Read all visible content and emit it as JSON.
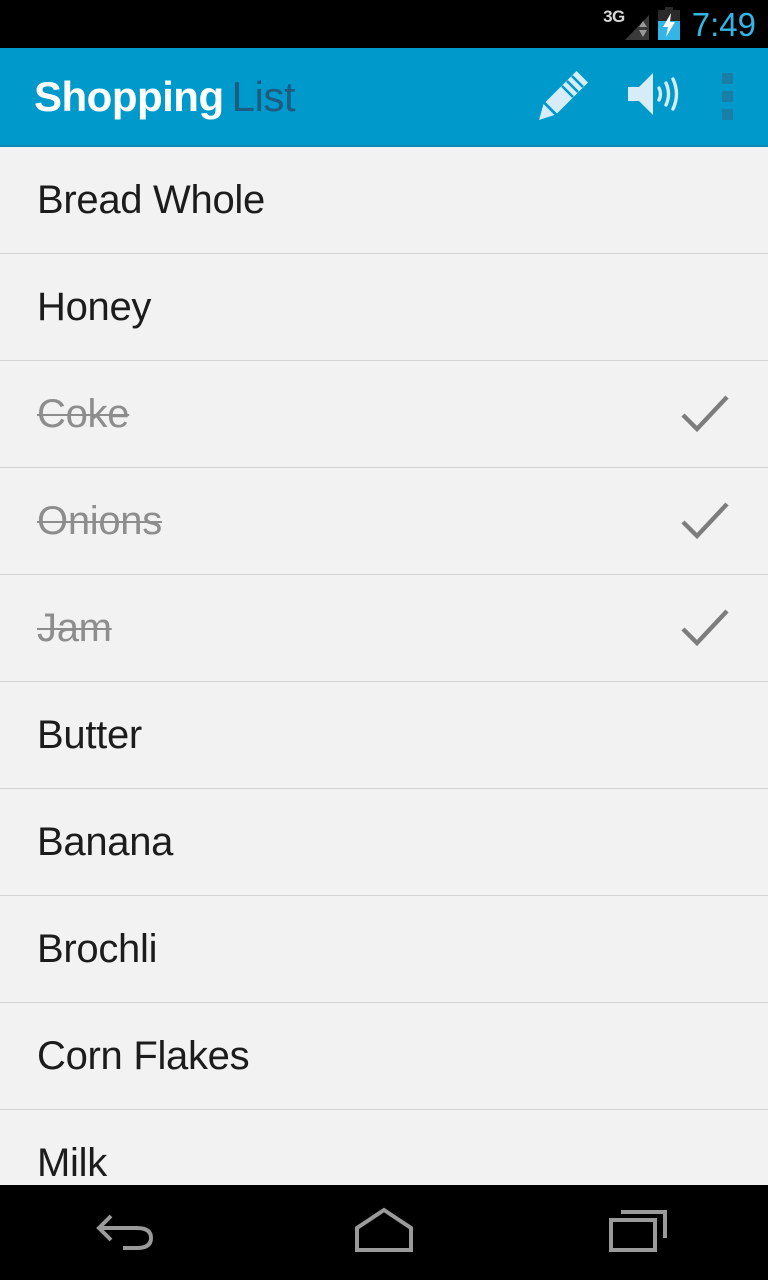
{
  "status_bar": {
    "network_label": "3G",
    "time": "7:49",
    "signal_icon": "signal-triangle-icon",
    "battery_icon": "battery-charging-icon",
    "time_color": "#33b5e5",
    "background": "#000000"
  },
  "action_bar": {
    "title_strong": "Shopping",
    "title_light": "List",
    "background": "#0099cc",
    "title_strong_color": "#ffffff",
    "title_light_color": "#1d5b80",
    "actions": [
      {
        "name": "edit-button",
        "icon": "pencil-icon"
      },
      {
        "name": "speak-button",
        "icon": "speaker-icon"
      },
      {
        "name": "overflow-button",
        "icon": "more-vertical-icon"
      }
    ]
  },
  "list": {
    "background": "#f2f2f2",
    "divider_color": "#d5d5d5",
    "item_text_color": "#1c1c1c",
    "done_text_color": "#8d8d8d",
    "check_color": "#7d7d7d",
    "items": [
      {
        "label": "Bread Whole",
        "done": false
      },
      {
        "label": "Honey",
        "done": false
      },
      {
        "label": "Coke",
        "done": true
      },
      {
        "label": "Onions",
        "done": true
      },
      {
        "label": "Jam",
        "done": true
      },
      {
        "label": "Butter",
        "done": false
      },
      {
        "label": "Banana",
        "done": false
      },
      {
        "label": "Brochli",
        "done": false
      },
      {
        "label": "Corn Flakes",
        "done": false
      },
      {
        "label": "Milk",
        "done": false
      }
    ]
  },
  "nav_bar": {
    "background": "#000000",
    "icon_color": "#9a9a9a",
    "buttons": [
      {
        "name": "nav-back-button",
        "icon": "back-arrow-icon"
      },
      {
        "name": "nav-home-button",
        "icon": "home-icon"
      },
      {
        "name": "nav-recents-button",
        "icon": "recents-icon"
      }
    ]
  }
}
